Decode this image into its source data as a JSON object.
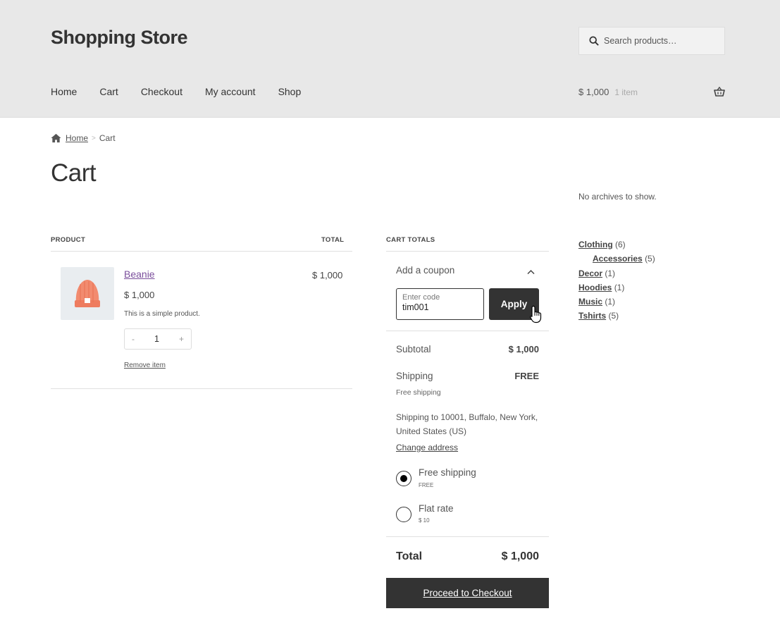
{
  "site": {
    "title": "Shopping Store"
  },
  "search": {
    "placeholder": "Search products…"
  },
  "nav": [
    "Home",
    "Cart",
    "Checkout",
    "My account",
    "Shop"
  ],
  "mini_cart": {
    "amount": "$ 1,000",
    "count": "1 item"
  },
  "breadcrumb": {
    "home": "Home",
    "current": "Cart"
  },
  "page": {
    "title": "Cart"
  },
  "cart_table": {
    "headers": {
      "product": "PRODUCT",
      "total": "TOTAL"
    },
    "items": [
      {
        "name": "Beanie",
        "price": "$ 1,000",
        "description": "This is a simple product.",
        "quantity": "1",
        "minus": "-",
        "plus": "+",
        "remove": "Remove item",
        "line_total": "$ 1,000"
      }
    ]
  },
  "totals": {
    "heading": "CART TOTALS",
    "coupon": {
      "label": "Add a coupon",
      "placeholder": "Enter code",
      "value": "tim001",
      "apply": "Apply"
    },
    "subtotal": {
      "label": "Subtotal",
      "value": "$ 1,000"
    },
    "shipping": {
      "label": "Shipping",
      "value": "FREE",
      "method": "Free shipping",
      "address": "Shipping to 10001, Buffalo, New York, United States (US)",
      "change": "Change address",
      "options": [
        {
          "label": "Free shipping",
          "price": "FREE",
          "selected": true
        },
        {
          "label": "Flat rate",
          "price": "$ 10",
          "selected": false
        }
      ]
    },
    "total": {
      "label": "Total",
      "value": "$ 1,000"
    },
    "checkout": "Proceed to Checkout"
  },
  "sidebar": {
    "archives": "No archives to show.",
    "categories": [
      {
        "name": "Clothing",
        "count": "(6)",
        "sub": false
      },
      {
        "name": "Accessories",
        "count": "(5)",
        "sub": true
      },
      {
        "name": "Decor",
        "count": "(1)",
        "sub": false
      },
      {
        "name": "Hoodies",
        "count": "(1)",
        "sub": false
      },
      {
        "name": "Music",
        "count": "(1)",
        "sub": false
      },
      {
        "name": "Tshirts",
        "count": "(5)",
        "sub": false
      }
    ]
  },
  "colors": {
    "header_bg": "#e8e8e8",
    "button_bg": "#333333",
    "link_purple": "#7b4f9c"
  }
}
